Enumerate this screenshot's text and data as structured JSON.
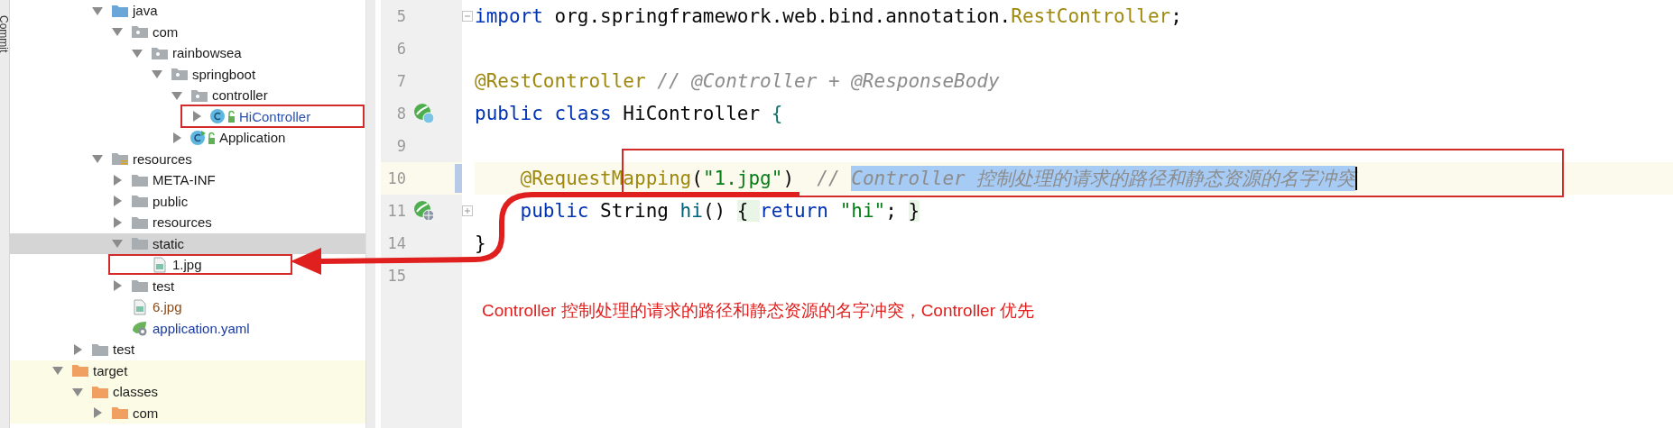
{
  "tool_strip": {
    "tabs": [
      {
        "label": "Commit"
      }
    ]
  },
  "project_tree": {
    "items": [
      {
        "children": [
          {
            "children": [
              {
                "label": "java",
                "kind": "source-folder",
                "expanded": true,
                "selected": false,
                "children": [
                  {
                    "label": "com",
                    "kind": "package",
                    "expanded": true,
                    "selected": false,
                    "children": [
                      {
                        "label": "rainbowsea",
                        "kind": "package",
                        "expanded": true,
                        "selected": false,
                        "children": [
                          {
                            "label": "springboot",
                            "kind": "package",
                            "expanded": true,
                            "selected": false,
                            "children": [
                              {
                                "label": "controller",
                                "kind": "package",
                                "expanded": true,
                                "selected": false,
                                "children": [
                                  {
                                    "label": "HiController",
                                    "kind": "class",
                                    "expanded": false,
                                    "selected": false,
                                    "color": "#2750b0"
                                  }
                                ]
                              },
                              {
                                "label": "Application",
                                "kind": "spring-class",
                                "expanded": false,
                                "selected": false
                              }
                            ]
                          }
                        ]
                      }
                    ]
                  }
                ]
              },
              {
                "label": "resources",
                "kind": "resources-root",
                "expanded": true,
                "selected": false,
                "children": [
                  {
                    "label": "META-INF",
                    "kind": "folder",
                    "expanded": false,
                    "selected": false
                  },
                  {
                    "label": "public",
                    "kind": "folder",
                    "expanded": false,
                    "selected": false
                  },
                  {
                    "label": "resources",
                    "kind": "folder",
                    "expanded": false,
                    "selected": false
                  },
                  {
                    "label": "static",
                    "kind": "folder",
                    "expanded": true,
                    "selected": true,
                    "children": [
                      {
                        "label": "1.jpg",
                        "kind": "image",
                        "selected": false
                      }
                    ]
                  },
                  {
                    "label": "test",
                    "kind": "folder",
                    "expanded": false,
                    "selected": false
                  },
                  {
                    "label": "6.jpg",
                    "kind": "image",
                    "selected": false,
                    "color": "#8a4a17"
                  },
                  {
                    "label": "application.yaml",
                    "kind": "spring-config",
                    "selected": false,
                    "color": "#1a3a9f"
                  }
                ]
              }
            ]
          },
          {
            "label": "test",
            "kind": "folder",
            "expanded": false,
            "selected": false
          }
        ]
      },
      {
        "label": "target",
        "kind": "excluded-folder",
        "expanded": true,
        "selected": false,
        "excluded": true,
        "children": [
          {
            "label": "classes",
            "kind": "excluded-folder",
            "expanded": true,
            "selected": false,
            "children": [
              {
                "label": "com",
                "kind": "excluded-folder",
                "expanded": false,
                "selected": false
              }
            ]
          }
        ]
      }
    ]
  },
  "editor": {
    "lines": [
      {
        "number": "5",
        "fold": {
          "folded": false
        },
        "tokens": [
          {
            "kind": "keyword",
            "text": "import",
            "selected": false
          },
          {
            "kind": "plain",
            "text": " org.springframework.web.bind.annotation.",
            "selected": false
          },
          {
            "kind": "annotation",
            "text": "RestController",
            "selected": false
          },
          {
            "kind": "plain",
            "text": ";",
            "selected": false
          }
        ]
      },
      {
        "number": "6"
      },
      {
        "number": "7",
        "tokens": [
          {
            "kind": "annotation",
            "text": "@RestController",
            "selected": false
          },
          {
            "kind": "comment",
            "text": " // @Controller + @ResponseBody",
            "selected": false
          }
        ]
      },
      {
        "number": "8",
        "gutter": {
          "kind": "bean-class"
        },
        "tokens": [
          {
            "kind": "keyword",
            "text": "public class",
            "selected": false
          },
          {
            "kind": "plain",
            "text": " HiController ",
            "selected": false
          },
          {
            "kind": "brace",
            "text": "{",
            "selected": false
          }
        ]
      },
      {
        "number": "9"
      },
      {
        "number": "10",
        "current": true,
        "changed": true,
        "indented": true,
        "tokens": [
          {
            "kind": "annotation",
            "text": "@RequestMapping",
            "selected": false
          },
          {
            "kind": "plain",
            "text": "(",
            "selected": false
          },
          {
            "kind": "string",
            "text": "\"1.jpg\"",
            "selected": false
          },
          {
            "kind": "plain",
            "text": ")  ",
            "selected": false
          },
          {
            "kind": "comment",
            "text": "// ",
            "selected": false
          },
          {
            "kind": "comment",
            "text": "Controller 控制处理的请求的路径和静态资源的名字冲突",
            "selected": true
          }
        ]
      },
      {
        "number": "11",
        "gutter": {
          "kind": "web-endpoint"
        },
        "fold": {
          "folded": true
        },
        "indented": true,
        "tokens": [
          {
            "kind": "keyword",
            "text": "public",
            "selected": false
          },
          {
            "kind": "plain",
            "text": " String ",
            "selected": false
          },
          {
            "kind": "method",
            "text": "hi",
            "selected": false
          },
          {
            "kind": "plain",
            "text": "() ",
            "selected": false
          },
          {
            "kind": "folded",
            "text": "{ ",
            "selected": false
          },
          {
            "kind": "keyword",
            "text": "return ",
            "selected": false
          },
          {
            "kind": "string",
            "text": "\"hi\"",
            "selected": false
          },
          {
            "kind": "plain",
            "text": "; ",
            "selected": false
          },
          {
            "kind": "folded",
            "text": "}",
            "selected": false
          }
        ]
      },
      {
        "number": "14",
        "tokens": [
          {
            "kind": "plain",
            "text": "}",
            "selected": false
          }
        ]
      },
      {
        "number": "15"
      }
    ]
  },
  "annotation": {
    "note": "Controller 控制处理的请求的路径和静态资源的名字冲突，Controller 优先"
  }
}
